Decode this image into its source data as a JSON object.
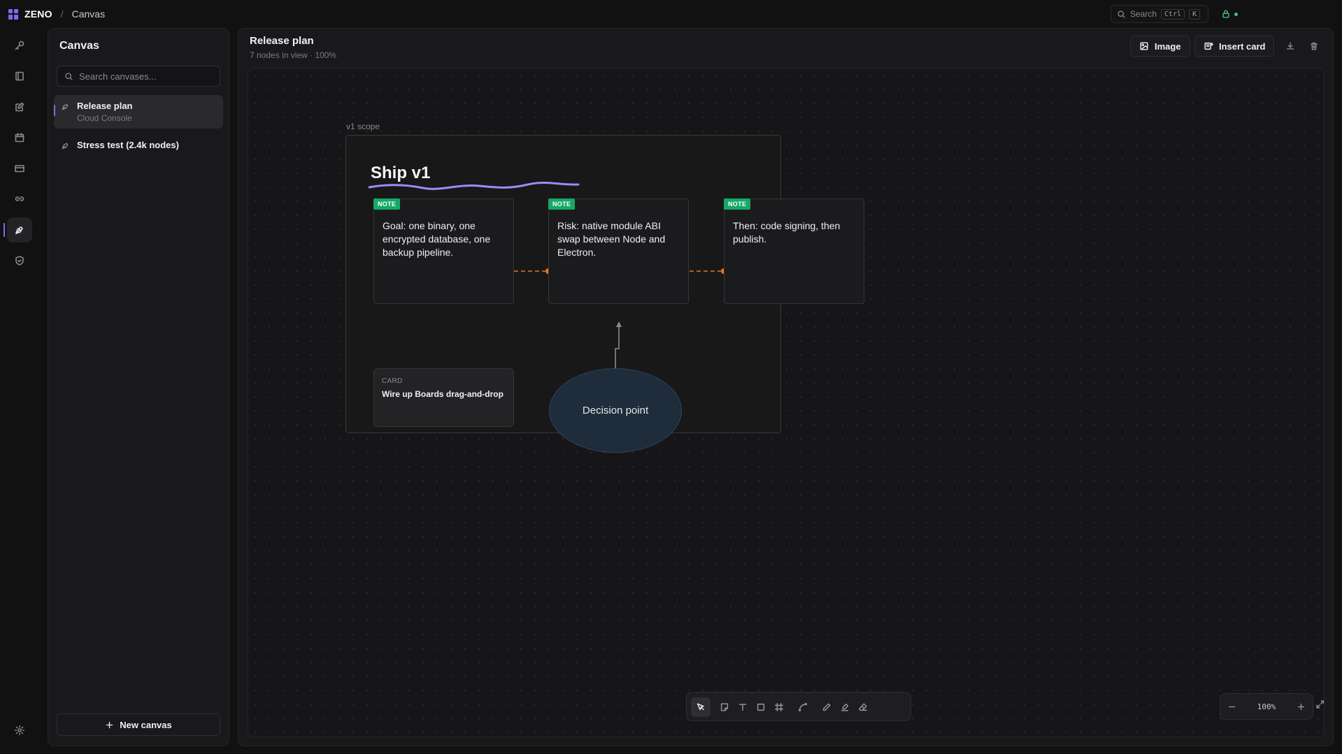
{
  "app": {
    "name": "ZENO",
    "breadcrumb": "Canvas"
  },
  "topbar": {
    "search_label": "Search",
    "shortcut_key1": "Ctrl",
    "shortcut_key2": "K"
  },
  "sidebar": {
    "title": "Canvas",
    "search_placeholder": "Search canvases...",
    "items": [
      {
        "name": "Release plan",
        "subtitle": "Cloud Console",
        "active": true
      },
      {
        "name": "Stress test (2.4k nodes)",
        "subtitle": "",
        "active": false
      }
    ],
    "new_canvas_label": "New canvas"
  },
  "main": {
    "title": "Release plan",
    "subtitle": "7 nodes in view · 100%",
    "image_button": "Image",
    "insert_card_button": "Insert card"
  },
  "canvas": {
    "frame_label": "v1 scope",
    "frame_title": "Ship v1",
    "notes": [
      {
        "tag": "NOTE",
        "text": "Goal: one binary, one encrypted database, one backup pipeline."
      },
      {
        "tag": "NOTE",
        "text": "Risk: native module ABI swap between Node and Electron."
      },
      {
        "tag": "NOTE",
        "text": "Then: code signing, then publish."
      }
    ],
    "card": {
      "kind": "CARD",
      "title": "Wire up Boards drag-and-drop"
    },
    "decision": "Decision point",
    "zoom_level": "100%"
  },
  "colors": {
    "accent": "#7b6cf6",
    "note_tag": "#17a867",
    "connector": "#e0762c",
    "status": "#3ec27a",
    "decision_fill": "#1e2c3b"
  },
  "icons": {
    "rail": [
      "key-icon",
      "book-icon",
      "edit-icon",
      "calendar-icon",
      "card-icon",
      "link-icon",
      "pen-nib-icon",
      "shield-icon",
      "gear-icon"
    ],
    "tools": [
      "pointer-icon",
      "sticky-note-icon",
      "text-icon",
      "rectangle-icon",
      "frame-icon",
      "connector-icon",
      "pencil-icon",
      "highlighter-icon",
      "eraser-icon"
    ]
  }
}
